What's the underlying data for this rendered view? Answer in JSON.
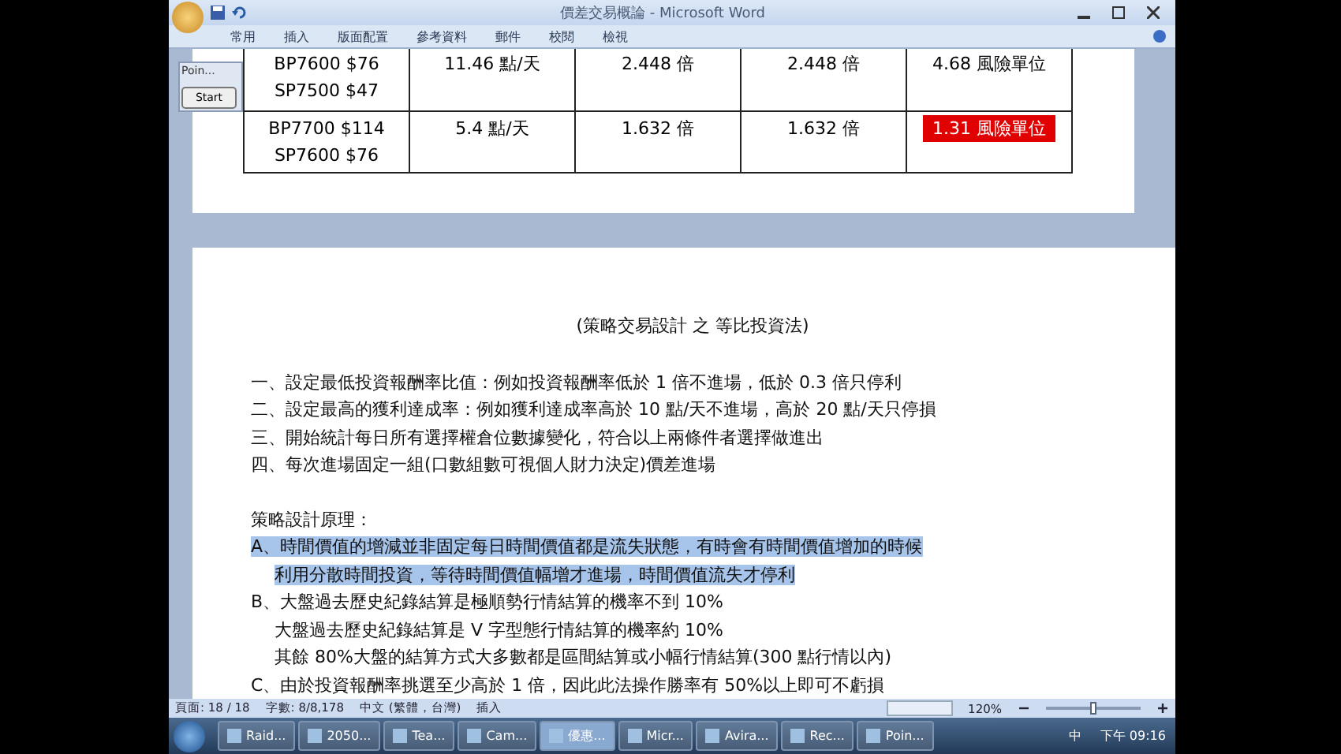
{
  "window": {
    "title": "價差交易概論 - Microsoft Word"
  },
  "ribbon_tabs": [
    "常用",
    "插入",
    "版面配置",
    "參考資料",
    "郵件",
    "校閱",
    "檢視"
  ],
  "floating_window": {
    "title": "Poin...",
    "button": "Start"
  },
  "table": {
    "rows": [
      {
        "cells": [
          {
            "lines": [
              "BP7600 $76",
              "SP7500 $47"
            ],
            "highlighted": false
          },
          {
            "lines": [
              "11.46 點/天"
            ],
            "highlighted": false
          },
          {
            "lines": [
              "2.448 倍"
            ],
            "highlighted": false
          },
          {
            "lines": [
              "2.448 倍"
            ],
            "highlighted": false
          },
          {
            "lines": [
              "4.68 風險單位"
            ],
            "highlighted": false
          }
        ]
      },
      {
        "cells": [
          {
            "lines": [
              "BP7700 $114",
              "SP7600 $76"
            ],
            "highlighted": false
          },
          {
            "lines": [
              "5.4 點/天"
            ],
            "highlighted": false
          },
          {
            "lines": [
              "1.632 倍"
            ],
            "highlighted": false
          },
          {
            "lines": [
              "1.632 倍"
            ],
            "highlighted": false
          },
          {
            "lines": [
              "1.31 風險單位"
            ],
            "highlighted": true
          }
        ]
      }
    ]
  },
  "document": {
    "title": "(策略交易設計 之 等比投資法)",
    "rules": [
      "一、設定最低投資報酬率比值：例如投資報酬率低於 1 倍不進場，低於 0.3 倍只停利",
      "二、設定最高的獲利達成率：例如獲利達成率高於 10 點/天不進場，高於 20 點/天只停損",
      "三、開始統計每日所有選擇權倉位數據變化，符合以上兩條件者選擇做進出",
      "四、每次進場固定一組(口數組數可視個人財力決定)價差進場"
    ],
    "principles_heading": "策略設計原理：",
    "principles": [
      {
        "kind": "item",
        "text": "A、時間價值的增減並非固定每日時間價值都是流失狀態，有時會有時間價值增加的時候",
        "selected": true
      },
      {
        "kind": "continuation",
        "text": "利用分散時間投資，等待時間價值幅增才進場，時間價值流失才停利",
        "selected": true
      },
      {
        "kind": "item",
        "text": "B、大盤過去歷史紀錄結算是極順勢行情結算的機率不到 10%",
        "selected": false
      },
      {
        "kind": "continuation",
        "text": "大盤過去歷史紀錄結算是 V 字型態行情結算的機率約 10%",
        "selected": false
      },
      {
        "kind": "continuation",
        "text": "其餘 80%大盤的結算方式大多數都是區間結算或小幅行情結算(300 點行情以內)",
        "selected": false
      },
      {
        "kind": "item",
        "text": "C、由於投資報酬率挑選至少高於 1 倍，因此此法操作勝率有 50%以上即可不虧損",
        "selected": false
      }
    ]
  },
  "status_bar": {
    "page": "頁面: 18 / 18",
    "words": "字數: 8/8,178",
    "language": "中文 (繁體，台灣)",
    "mode": "插入",
    "zoom": "120%",
    "zoom_slider": {
      "level": 0.5
    }
  },
  "taskbar": {
    "items": [
      {
        "label": "Raid...",
        "selected": false
      },
      {
        "label": "2050...",
        "selected": false
      },
      {
        "label": "Tea...",
        "selected": false
      },
      {
        "label": "Cam...",
        "selected": false
      },
      {
        "label": "優惠...",
        "selected": true
      },
      {
        "label": "Micr...",
        "selected": false
      },
      {
        "label": "Avira...",
        "selected": false
      },
      {
        "label": "Rec...",
        "selected": false
      },
      {
        "label": "Poin...",
        "selected": false
      }
    ],
    "ime": "中",
    "clock": "下午 09:16"
  }
}
